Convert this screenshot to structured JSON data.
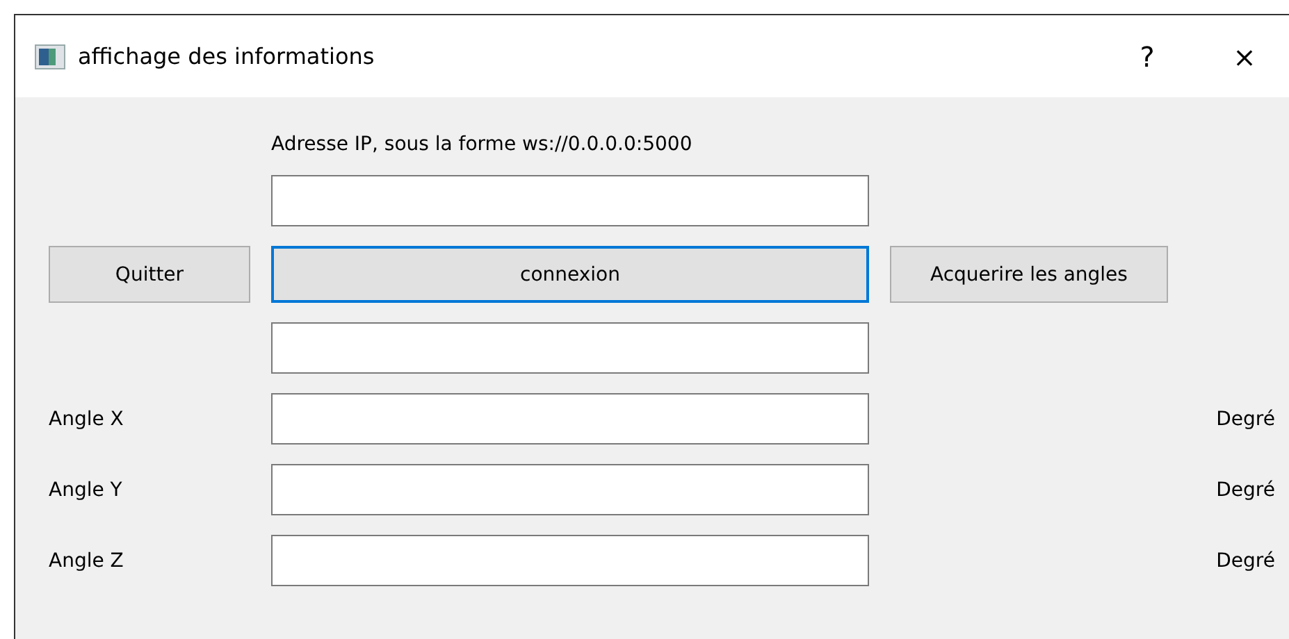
{
  "window": {
    "title": "affichage des informations",
    "help": "?",
    "close": "×"
  },
  "ip_label": "Adresse IP, sous la forme ws://0.0.0.0:5000",
  "buttons": [
    {
      "label": "Quitter",
      "focused": false
    },
    {
      "label": "connexion",
      "focused": true
    },
    {
      "label": "Acquerire les angles",
      "focused": false
    }
  ],
  "angles": [
    {
      "label": "Angle X",
      "unit": "Degré"
    },
    {
      "label": "Angle Y",
      "unit": "Degré"
    },
    {
      "label": "Angle Z",
      "unit": "Degré"
    }
  ]
}
